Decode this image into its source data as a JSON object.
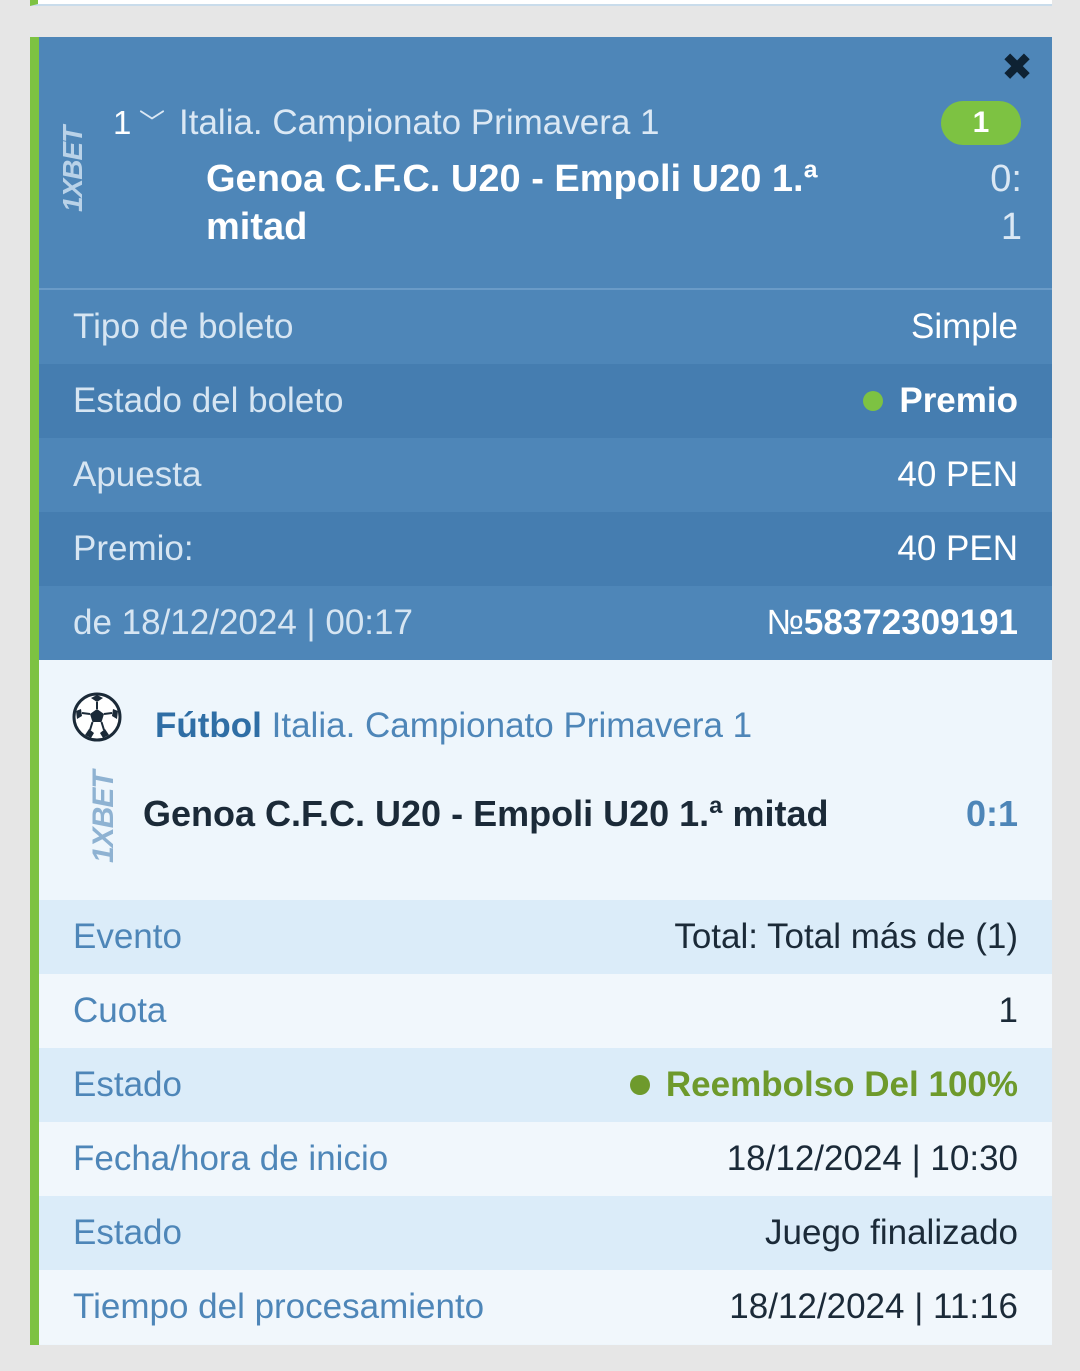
{
  "header": {
    "logo": "1XBET",
    "count": "1",
    "league": "Italia. Campionato Primavera 1",
    "badge": "1",
    "match": "Genoa C.F.C. U20 - Empoli U20 1.ª mitad",
    "score_line1": "0:",
    "score_line2": "1",
    "icons": {
      "close": "close-icon",
      "expand": "chevron-down-icon"
    }
  },
  "ticket": {
    "rows": [
      {
        "label": "Tipo de boleto",
        "value": "Simple"
      },
      {
        "label": "Estado del boleto",
        "value": "Premio"
      },
      {
        "label": "Apuesta",
        "value": "40 PEN"
      },
      {
        "label": "Premio:",
        "value": "40 PEN"
      }
    ],
    "date": "de 18/12/2024 | 00:17",
    "number_prefix": "№",
    "number": "58372309191"
  },
  "event": {
    "logo": "1XBET",
    "sport": "Fútbol",
    "league": "Italia. Campionato Primavera 1",
    "match": "Genoa C.F.C. U20 - Empoli U20 1.ª mitad",
    "score": "0:1",
    "rows": [
      {
        "label": "Evento",
        "value": "Total: Total más de (1)"
      },
      {
        "label": "Cuota",
        "value": "1"
      },
      {
        "label": "Estado",
        "value": "Reembolso Del 100%"
      },
      {
        "label": "Fecha/hora de inicio",
        "value": "18/12/2024 | 10:30"
      },
      {
        "label": "Estado",
        "value": "Juego finalizado"
      },
      {
        "label": "Tiempo del procesamiento",
        "value": "18/12/2024 | 11:16"
      }
    ]
  },
  "colors": {
    "accent_green": "#7dc242",
    "header_blue": "#4e86b8",
    "status_green": "#6e9a2c"
  }
}
